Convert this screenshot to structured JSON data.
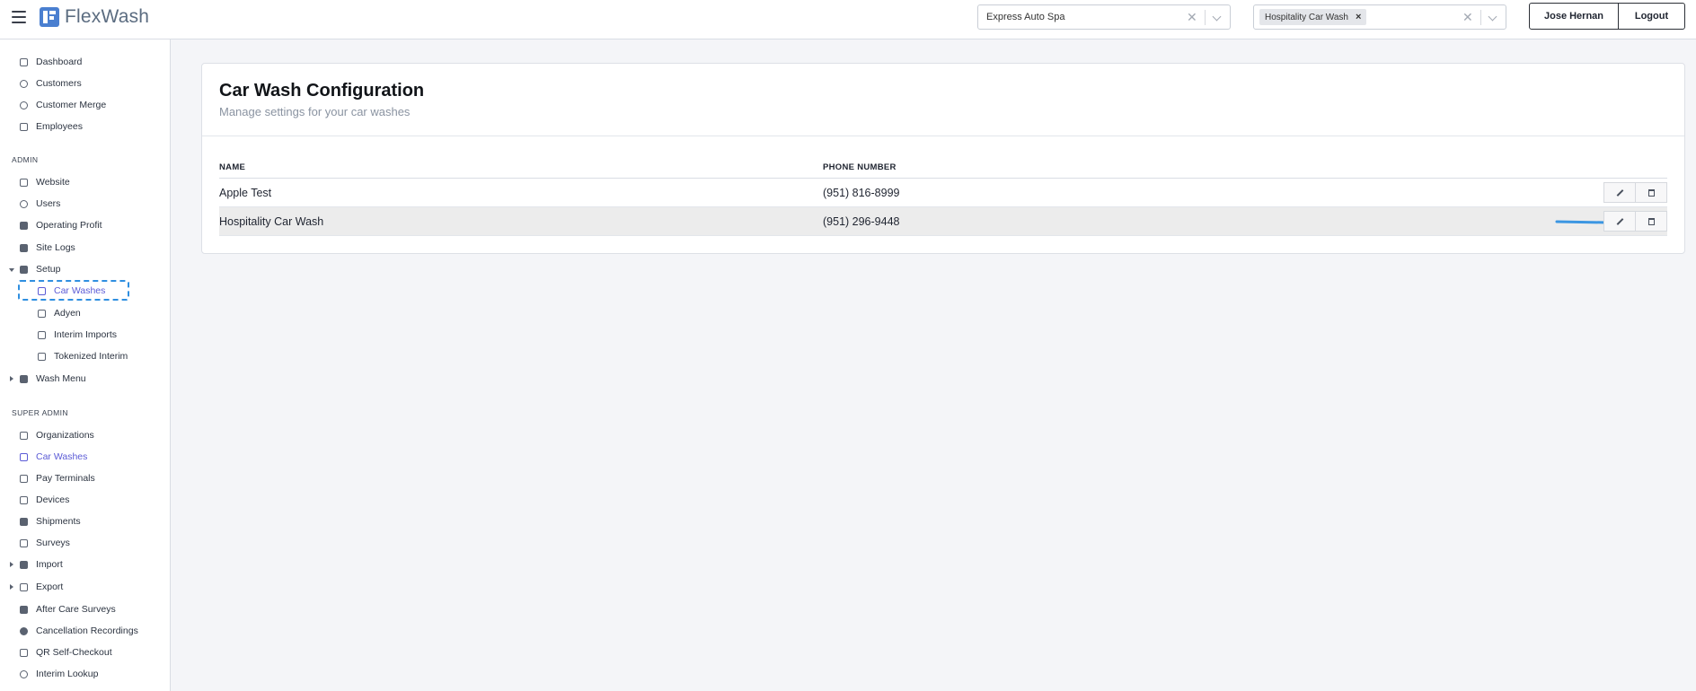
{
  "app": {
    "name": "FlexWash"
  },
  "header": {
    "location_select": {
      "value": "Express Auto Spa"
    },
    "carwash_select": {
      "chip": "Hospitality Car Wash",
      "chip_remove": "×"
    },
    "user_name": "Jose Hernan",
    "logout_label": "Logout"
  },
  "sidebar": {
    "top": [
      {
        "label": "Dashboard"
      },
      {
        "label": "Customers"
      },
      {
        "label": "Customer Merge"
      },
      {
        "label": "Employees"
      }
    ],
    "admin_label": "ADMIN",
    "admin": [
      {
        "label": "Website"
      },
      {
        "label": "Users"
      },
      {
        "label": "Operating Profit"
      },
      {
        "label": "Site Logs"
      },
      {
        "label": "Setup"
      },
      {
        "label": "Car Washes"
      },
      {
        "label": "Adyen"
      },
      {
        "label": "Interim Imports"
      },
      {
        "label": "Tokenized Interim"
      },
      {
        "label": "Wash Menu"
      }
    ],
    "super_admin_label": "SUPER ADMIN",
    "super_admin": [
      {
        "label": "Organizations"
      },
      {
        "label": "Car Washes"
      },
      {
        "label": "Pay Terminals"
      },
      {
        "label": "Devices"
      },
      {
        "label": "Shipments"
      },
      {
        "label": "Surveys"
      },
      {
        "label": "Import"
      },
      {
        "label": "Export"
      },
      {
        "label": "After Care Surveys"
      },
      {
        "label": "Cancellation Recordings"
      },
      {
        "label": "QR Self-Checkout"
      },
      {
        "label": "Interim Lookup"
      }
    ]
  },
  "main": {
    "title": "Car Wash Configuration",
    "subtitle": "Manage settings for your car washes",
    "columns": [
      "NAME",
      "PHONE NUMBER"
    ],
    "rows": [
      {
        "name": "Apple Test",
        "phone": "(951) 816-8999"
      },
      {
        "name": "Hospitality Car Wash",
        "phone": "(951) 296-9448"
      }
    ]
  },
  "colors": {
    "accent": "#5b5bd6",
    "annotation": "#2f8fe0",
    "brand": "#4a7fd0"
  }
}
